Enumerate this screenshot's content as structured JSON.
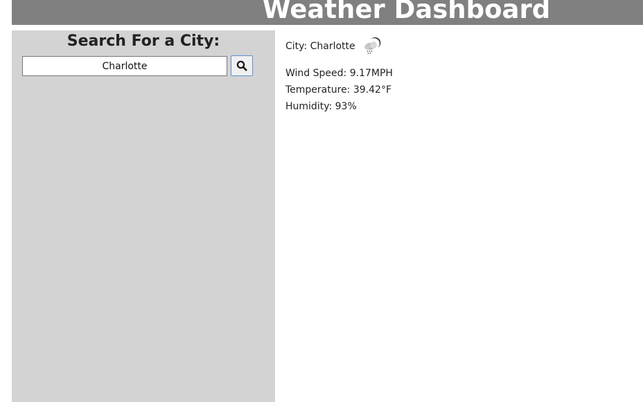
{
  "header": {
    "title": "Weather Dashboard"
  },
  "sidebar": {
    "heading": "Search For a City:",
    "search": {
      "value": "Charlotte",
      "button_icon": "search-icon"
    }
  },
  "weather": {
    "city_label": "City:",
    "city": "Charlotte",
    "icon": "rain-cloud-icon",
    "wind_speed_label": "Wind Speed:",
    "wind_speed": "9.17MPH",
    "temperature_label": "Temperature:",
    "temperature": "39.42°F",
    "humidity_label": "Humidity:",
    "humidity": "93%"
  },
  "colors": {
    "header_bg": "#808080",
    "sidebar_bg": "#d3d3d3",
    "button_border": "#5b8fd6"
  }
}
